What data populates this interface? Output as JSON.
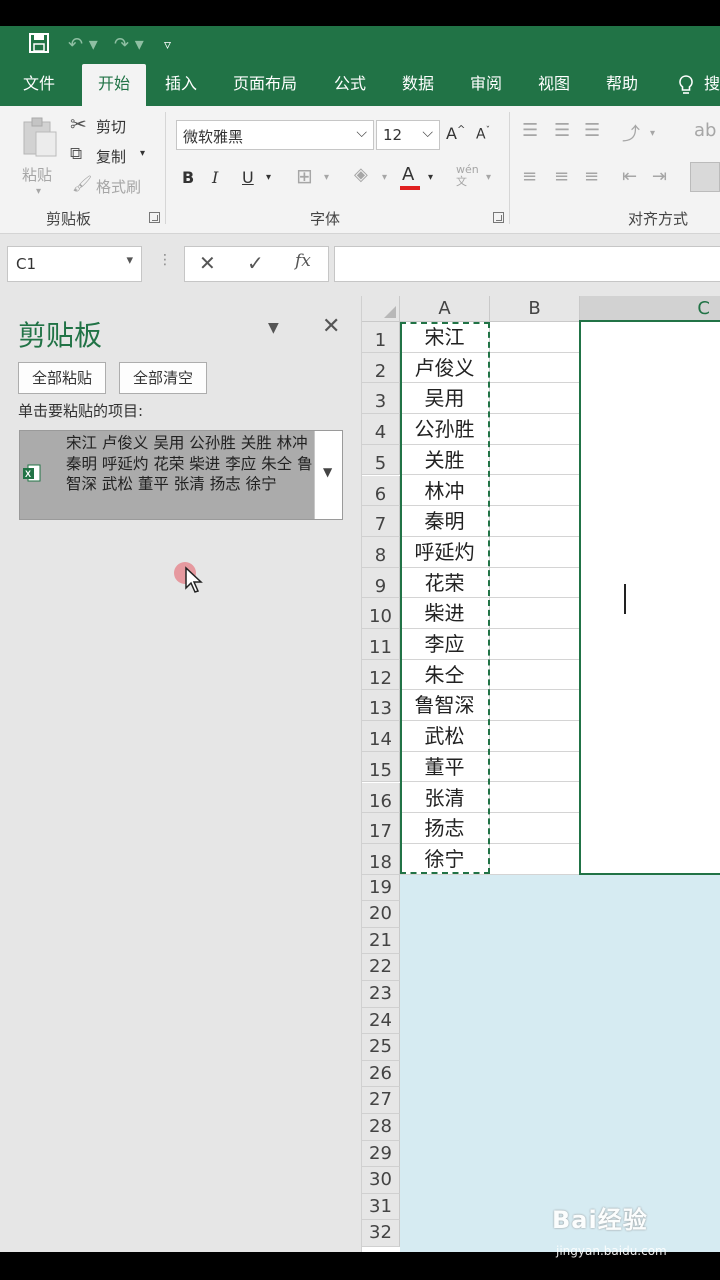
{
  "title_bar": {
    "icons": [
      "save-icon",
      "undo-icon",
      "redo-icon",
      "customize-qat-icon"
    ]
  },
  "tabs": [
    {
      "label": "文件",
      "active": false
    },
    {
      "label": "开始",
      "active": true
    },
    {
      "label": "插入",
      "active": false
    },
    {
      "label": "页面布局",
      "active": false
    },
    {
      "label": "公式",
      "active": false
    },
    {
      "label": "数据",
      "active": false
    },
    {
      "label": "审阅",
      "active": false
    },
    {
      "label": "视图",
      "active": false
    },
    {
      "label": "帮助",
      "active": false
    },
    {
      "label": "搜",
      "active": false
    }
  ],
  "ribbon": {
    "clipboard": {
      "paste": "粘贴",
      "cut": "剪切",
      "copy": "复制",
      "format_painter": "格式刷",
      "group_label": "剪贴板"
    },
    "font": {
      "font_name": "微软雅黑",
      "font_size": "12",
      "bold": "B",
      "italic": "I",
      "underline": "U",
      "phonetic": "wén文",
      "group_label": "字体"
    },
    "alignment": {
      "group_label": "对齐方式"
    }
  },
  "formula_bar": {
    "name_box": "C1",
    "cancel": "✕",
    "enter": "✓",
    "fx": "fx",
    "value": ""
  },
  "clipboard_pane": {
    "title": "剪贴板",
    "paste_all": "全部粘贴",
    "clear_all": "全部清空",
    "hint": "单击要粘贴的项目:",
    "item_text": "宋江 卢俊义 吴用 公孙胜 关胜 林冲 秦明 呼延灼 花荣 柴进 李应 朱仝 鲁智深 武松 董平 张清 扬志 徐宁"
  },
  "sheet": {
    "columns": [
      "A",
      "B",
      "C"
    ],
    "selected_column": "C",
    "rows": [
      {
        "n": "1",
        "a": "宋江"
      },
      {
        "n": "2",
        "a": "卢俊义"
      },
      {
        "n": "3",
        "a": "吴用"
      },
      {
        "n": "4",
        "a": "公孙胜"
      },
      {
        "n": "5",
        "a": "关胜"
      },
      {
        "n": "6",
        "a": "林冲"
      },
      {
        "n": "7",
        "a": "秦明"
      },
      {
        "n": "8",
        "a": "呼延灼"
      },
      {
        "n": "9",
        "a": "花荣"
      },
      {
        "n": "10",
        "a": "柴进"
      },
      {
        "n": "11",
        "a": "李应"
      },
      {
        "n": "12",
        "a": "朱仝"
      },
      {
        "n": "13",
        "a": "鲁智深"
      },
      {
        "n": "14",
        "a": "武松"
      },
      {
        "n": "15",
        "a": "董平"
      },
      {
        "n": "16",
        "a": "张清"
      },
      {
        "n": "17",
        "a": "扬志"
      },
      {
        "n": "18",
        "a": "徐宁"
      },
      {
        "n": "19",
        "a": ""
      },
      {
        "n": "20",
        "a": ""
      },
      {
        "n": "21",
        "a": ""
      },
      {
        "n": "22",
        "a": ""
      },
      {
        "n": "23",
        "a": ""
      },
      {
        "n": "24",
        "a": ""
      },
      {
        "n": "25",
        "a": ""
      },
      {
        "n": "26",
        "a": ""
      },
      {
        "n": "27",
        "a": ""
      },
      {
        "n": "28",
        "a": ""
      },
      {
        "n": "29",
        "a": ""
      },
      {
        "n": "30",
        "a": ""
      },
      {
        "n": "31",
        "a": ""
      },
      {
        "n": "32",
        "a": ""
      }
    ]
  },
  "watermark": {
    "brand": "Bai经验",
    "url": "jingyan.baidu.com"
  },
  "colors": {
    "excel_green": "#217346",
    "ribbon_bg": "#f3f3f3",
    "pane_bg": "#e6e6e6",
    "selection_fill": "#d6ebf2"
  }
}
